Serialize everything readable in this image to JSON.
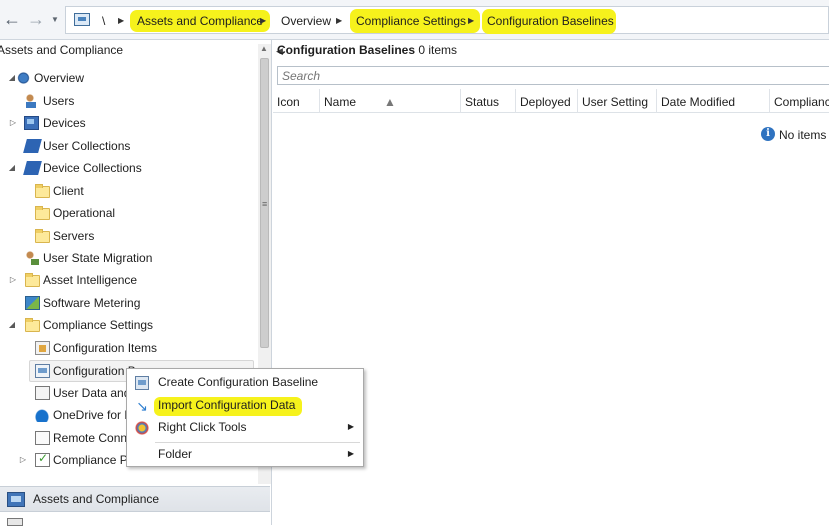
{
  "breadcrumb": {
    "root": "\\",
    "items": [
      "Assets and Compliance",
      "Overview",
      "Compliance Settings",
      "Configuration Baselines"
    ],
    "highlight_color": "#f6f21c"
  },
  "navigation": {
    "title": "Assets and Compliance",
    "tree": [
      {
        "label": "Overview",
        "icon": "overview-icon",
        "expander": "expanded"
      },
      {
        "label": "Users",
        "icon": "users-icon",
        "expander": "none"
      },
      {
        "label": "Devices",
        "icon": "devices-icon",
        "expander": "collapsed"
      },
      {
        "label": "User Collections",
        "icon": "user-collections-icon",
        "expander": "none"
      },
      {
        "label": "Device Collections",
        "icon": "device-collections-icon",
        "expander": "expanded"
      },
      {
        "label": "Client",
        "icon": "folder-icon",
        "expander": "none"
      },
      {
        "label": "Operational",
        "icon": "folder-icon",
        "expander": "none"
      },
      {
        "label": "Servers",
        "icon": "folder-icon",
        "expander": "none"
      },
      {
        "label": "User State Migration",
        "icon": "user-state-migration-icon",
        "expander": "none"
      },
      {
        "label": "Asset Intelligence",
        "icon": "folder-icon",
        "expander": "collapsed"
      },
      {
        "label": "Software Metering",
        "icon": "software-metering-icon",
        "expander": "none"
      },
      {
        "label": "Compliance Settings",
        "icon": "folder-icon",
        "expander": "expanded"
      },
      {
        "label": "Configuration Items",
        "icon": "configuration-items-icon",
        "expander": "none"
      },
      {
        "label": "Configuration B",
        "icon": "configuration-baselines-icon",
        "expander": "none",
        "selected": true
      },
      {
        "label": "User Data and",
        "icon": "user-data-icon",
        "expander": "none"
      },
      {
        "label": "OneDrive for B",
        "icon": "onedrive-icon",
        "expander": "none"
      },
      {
        "label": "Remote Conne",
        "icon": "remote-connection-icon",
        "expander": "none"
      },
      {
        "label": "Compliance Po",
        "icon": "compliance-policies-icon",
        "expander": "collapsed"
      }
    ],
    "workspace_button": "Assets and Compliance"
  },
  "content": {
    "title": "Configuration Baselines",
    "count": "0 items",
    "search_placeholder": "Search",
    "columns": [
      "Icon",
      "Name",
      "Status",
      "Deployed",
      "User Setting",
      "Date Modified",
      "Compliance"
    ],
    "empty_message": "No items f"
  },
  "context_menu": {
    "items": [
      {
        "label": "Create Configuration Baseline",
        "icon": "create-baseline-icon",
        "submenu": false
      },
      {
        "label": "Import Configuration Data",
        "icon": "import-arrow-icon",
        "submenu": false,
        "highlighted": true
      },
      {
        "label": "Right Click Tools",
        "icon": "right-click-tools-icon",
        "submenu": true
      },
      {
        "label": "Folder",
        "icon": "",
        "submenu": true
      }
    ]
  }
}
